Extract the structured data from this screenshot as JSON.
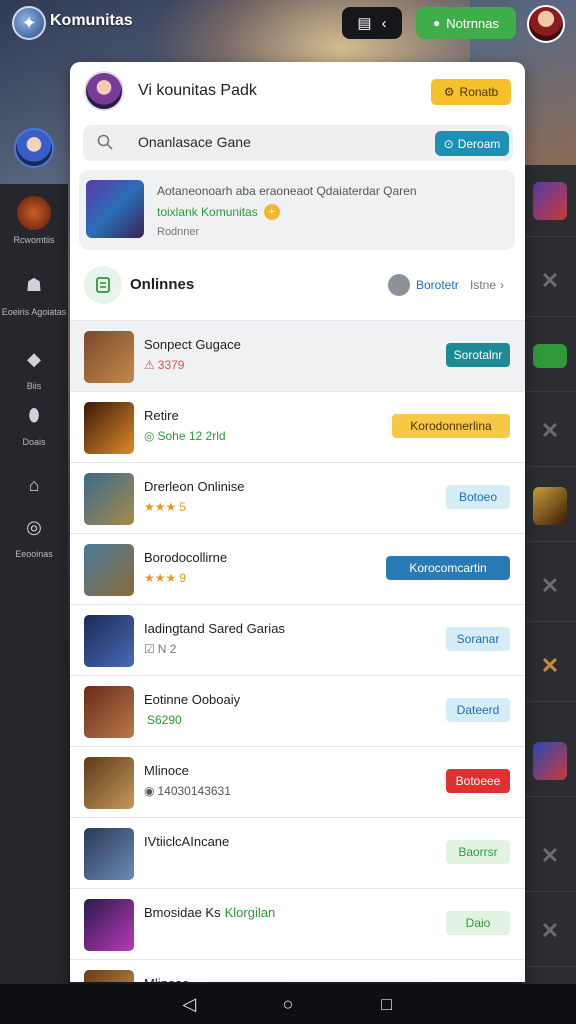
{
  "topbar": {
    "app_title": "Komunitas",
    "notif_label": "Notrnnas"
  },
  "sidebar": {
    "items": [
      {
        "label": "Rcwomtiis",
        "icon": "warrior-avatar-icon"
      },
      {
        "label": "Eoeiris Agoiatas",
        "icon": "helmet-icon"
      },
      {
        "label": "Biis",
        "icon": "chat-icon"
      },
      {
        "label": "Doais",
        "icon": "group-icon"
      },
      {
        "label": "",
        "icon": "store-icon"
      },
      {
        "label": "Eeooinas",
        "icon": "target-icon"
      }
    ]
  },
  "card": {
    "title": "Vi kounitas Padk",
    "manage_label": "Ronatb",
    "search": {
      "value": "Onanlasace Gane",
      "button_label": "Deroam"
    },
    "featured": {
      "line1": "Aotaneonoarh aba eraoneaot Qdaiaterdar Qaren",
      "line2": "toixlank Komunitas",
      "line3": "Rodnner"
    },
    "section": {
      "title": "Onlinnes",
      "link": "Borotetr",
      "more": "Istne"
    }
  },
  "games": [
    {
      "title": "Sonpect Gugace",
      "sub": "3379",
      "sub_prefix": "⚠",
      "sub_color": "#d9534f",
      "btn": "Sorotalnr",
      "btn_style": "teal",
      "thumb": "#7a4a2a,#c28a4a"
    },
    {
      "title": "Retire",
      "sub": "Sohe 12 2rld",
      "sub_prefix": "◎",
      "sub_color": "#2f9a3a",
      "btn": "Korodonnerlina",
      "btn_style": "yellow",
      "thumb": "#3a1a08,#e08a2a"
    },
    {
      "title": "Drerleon Onlinise",
      "sub": "5",
      "sub_prefix": "★★★",
      "sub_color": "#e39b1b",
      "btn": "Botoeo",
      "btn_style": "lightblue",
      "thumb": "#3a6a8a,#a88a4a"
    },
    {
      "title": "Borodocollirne",
      "sub": "9",
      "sub_prefix": "★★★",
      "sub_color": "#e39b1b",
      "btn": "Korocomcartin",
      "btn_style": "blue",
      "thumb": "#4a7a9a,#8a6a3a"
    },
    {
      "title": "Iadingtand Sared Garias",
      "sub": "N 2",
      "sub_prefix": "☑",
      "sub_color": "#777777",
      "btn": "Soranar",
      "btn_style": "lightblue",
      "thumb": "#1a2a55,#4a6ab8"
    },
    {
      "title": "Eotinne Ooboaiy",
      "sub": "S6290",
      "sub_prefix": "",
      "sub_color": "#2f9a3a",
      "btn": "Dateerd",
      "btn_style": "lightblue",
      "thumb": "#6a2a1a,#b87a4a"
    },
    {
      "title": "Mlinoce",
      "sub": "14030143631",
      "sub_prefix": "◉",
      "sub_color": "#555555",
      "btn": "Botoeee",
      "btn_style": "red",
      "thumb": "#5a3a1a,#c89a5a"
    },
    {
      "title": "IVtiiclcAIncane",
      "sub": "",
      "sub_prefix": "",
      "sub_color": "#555555",
      "btn": "Baorrsr",
      "btn_style": "lightgreen",
      "thumb": "#2a3a55,#6a8ab8"
    },
    {
      "title": "Bmosidae Ks",
      "title_extra": "Klorgilan",
      "sub": "",
      "sub_prefix": "",
      "sub_color": "#555555",
      "btn": "Daio",
      "btn_style": "lightgreen",
      "thumb": "#2a1a4a,#b83ab8"
    },
    {
      "title": "Mlinoac",
      "sub": "",
      "sub_prefix": "",
      "sub_color": "#555555",
      "btn": "",
      "btn_style": "lightblue",
      "thumb": "#6a3a1a,#c8a04a"
    }
  ],
  "colors": {
    "accent_green": "#3fae4a",
    "accent_yellow": "#f6c02a",
    "accent_teal": "#1e8fb5"
  }
}
